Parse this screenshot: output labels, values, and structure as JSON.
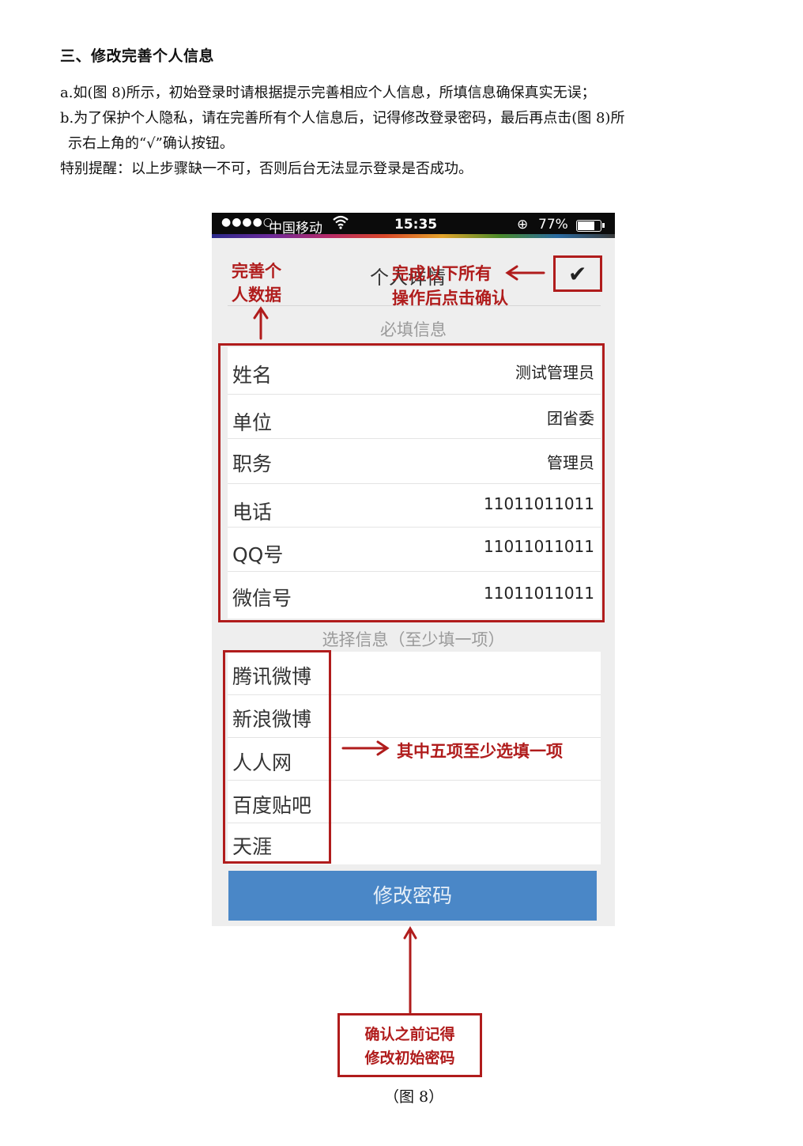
{
  "doc": {
    "heading": "三、修改完善个人信息",
    "line_a": "a.如(图 8)所示，初始登录时请根据提示完善相应个人信息，所填信息确保真实无误；",
    "line_b1": "b.为了保护个人隐私，请在完善所有个人信息后，记得修改登录密码，最后再点击(图 8)所",
    "line_b2": "示右上角的“√”确认按钮。",
    "line_c": "特别提醒：以上步骤缺一不可，否则后台无法显示登录是否成功。",
    "caption": "（图 8）"
  },
  "status_bar": {
    "signal": "●●●●○",
    "carrier": "中国移动",
    "wifi_icon": "wifi-icon",
    "time": "15:35",
    "lock_icon": "⊕",
    "battery": "77%"
  },
  "app": {
    "title": "个人详情",
    "confirm_symbol": "✔",
    "required_label": "必填信息",
    "required_fields": [
      {
        "label": "姓名",
        "value": "测试管理员"
      },
      {
        "label": "单位",
        "value": "团省委"
      },
      {
        "label": "职务",
        "value": "管理员"
      },
      {
        "label": "电话",
        "value": "11011011011"
      },
      {
        "label": "QQ号",
        "value": "11011011011"
      },
      {
        "label": "微信号",
        "value": "11011011011"
      }
    ],
    "optional_label": "选择信息（至少填一项）",
    "optional_fields": [
      {
        "label": "腾讯微博",
        "value": ""
      },
      {
        "label": "新浪微博",
        "value": ""
      },
      {
        "label": "人人网",
        "value": ""
      },
      {
        "label": "百度贴吧",
        "value": ""
      },
      {
        "label": "天涯",
        "value": ""
      }
    ],
    "change_password_label": "修改密码"
  },
  "annotations": {
    "complete_line1": "完善个",
    "complete_line2": "人数据",
    "confirm_line1": "完成以下所有",
    "confirm_line2": "操作后点击确认",
    "optional_note": "其中五项至少选填一项",
    "password_line1": "确认之前记得",
    "password_line2": "修改初始密码",
    "accent_color": "#b01c1c"
  }
}
